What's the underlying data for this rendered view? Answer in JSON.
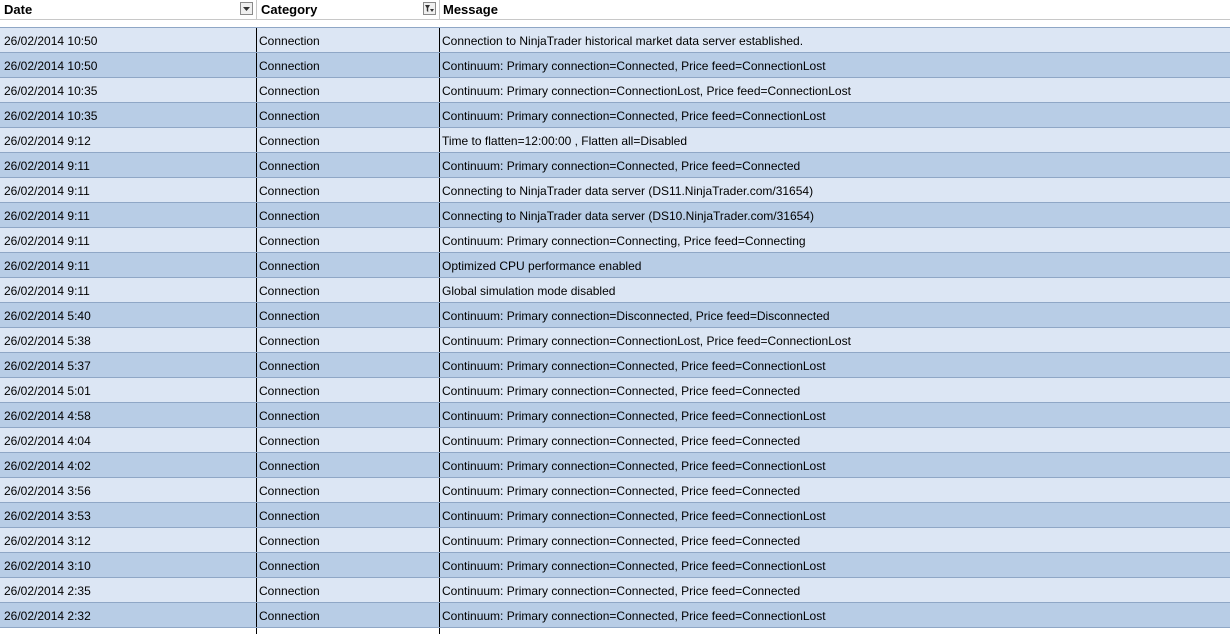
{
  "columns": {
    "date": "Date",
    "category": "Category",
    "message": "Message"
  },
  "icons": {
    "date_sort": "dropdown-arrow-icon",
    "category_filter": "filter-dropdown-icon"
  },
  "colors": {
    "row_light": "#dce6f4",
    "row_dark": "#b8cde6"
  },
  "rows": [
    {
      "date": "26/02/2014 10:50",
      "category": "Connection",
      "message": "Connection to NinjaTrader historical market data server established."
    },
    {
      "date": "26/02/2014 10:50",
      "category": "Connection",
      "message": "Continuum: Primary connection=Connected, Price feed=ConnectionLost"
    },
    {
      "date": "26/02/2014 10:35",
      "category": "Connection",
      "message": "Continuum: Primary connection=ConnectionLost, Price feed=ConnectionLost"
    },
    {
      "date": "26/02/2014 10:35",
      "category": "Connection",
      "message": "Continuum: Primary connection=Connected, Price feed=ConnectionLost"
    },
    {
      "date": "26/02/2014 9:12",
      "category": "Connection",
      "message": "Time to flatten=12:00:00 , Flatten all=Disabled"
    },
    {
      "date": "26/02/2014 9:11",
      "category": "Connection",
      "message": "Continuum: Primary connection=Connected, Price feed=Connected"
    },
    {
      "date": "26/02/2014 9:11",
      "category": "Connection",
      "message": "Connecting to NinjaTrader data server (DS11.NinjaTrader.com/31654)"
    },
    {
      "date": "26/02/2014 9:11",
      "category": "Connection",
      "message": "Connecting to NinjaTrader data server (DS10.NinjaTrader.com/31654)"
    },
    {
      "date": "26/02/2014 9:11",
      "category": "Connection",
      "message": "Continuum: Primary connection=Connecting, Price feed=Connecting"
    },
    {
      "date": "26/02/2014 9:11",
      "category": "Connection",
      "message": "Optimized CPU performance enabled"
    },
    {
      "date": "26/02/2014 9:11",
      "category": "Connection",
      "message": "Global simulation mode disabled"
    },
    {
      "date": "26/02/2014 5:40",
      "category": "Connection",
      "message": "Continuum: Primary connection=Disconnected, Price feed=Disconnected"
    },
    {
      "date": "26/02/2014 5:38",
      "category": "Connection",
      "message": "Continuum: Primary connection=ConnectionLost, Price feed=ConnectionLost"
    },
    {
      "date": "26/02/2014 5:37",
      "category": "Connection",
      "message": "Continuum: Primary connection=Connected, Price feed=ConnectionLost"
    },
    {
      "date": "26/02/2014 5:01",
      "category": "Connection",
      "message": "Continuum: Primary connection=Connected, Price feed=Connected"
    },
    {
      "date": "26/02/2014 4:58",
      "category": "Connection",
      "message": "Continuum: Primary connection=Connected, Price feed=ConnectionLost"
    },
    {
      "date": "26/02/2014 4:04",
      "category": "Connection",
      "message": "Continuum: Primary connection=Connected, Price feed=Connected"
    },
    {
      "date": "26/02/2014 4:02",
      "category": "Connection",
      "message": "Continuum: Primary connection=Connected, Price feed=ConnectionLost"
    },
    {
      "date": "26/02/2014 3:56",
      "category": "Connection",
      "message": "Continuum: Primary connection=Connected, Price feed=Connected"
    },
    {
      "date": "26/02/2014 3:53",
      "category": "Connection",
      "message": "Continuum: Primary connection=Connected, Price feed=ConnectionLost"
    },
    {
      "date": "26/02/2014 3:12",
      "category": "Connection",
      "message": "Continuum: Primary connection=Connected, Price feed=Connected"
    },
    {
      "date": "26/02/2014 3:10",
      "category": "Connection",
      "message": "Continuum: Primary connection=Connected, Price feed=ConnectionLost"
    },
    {
      "date": "26/02/2014 2:35",
      "category": "Connection",
      "message": "Continuum: Primary connection=Connected, Price feed=Connected"
    },
    {
      "date": "26/02/2014 2:32",
      "category": "Connection",
      "message": "Continuum: Primary connection=Connected, Price feed=ConnectionLost"
    }
  ]
}
